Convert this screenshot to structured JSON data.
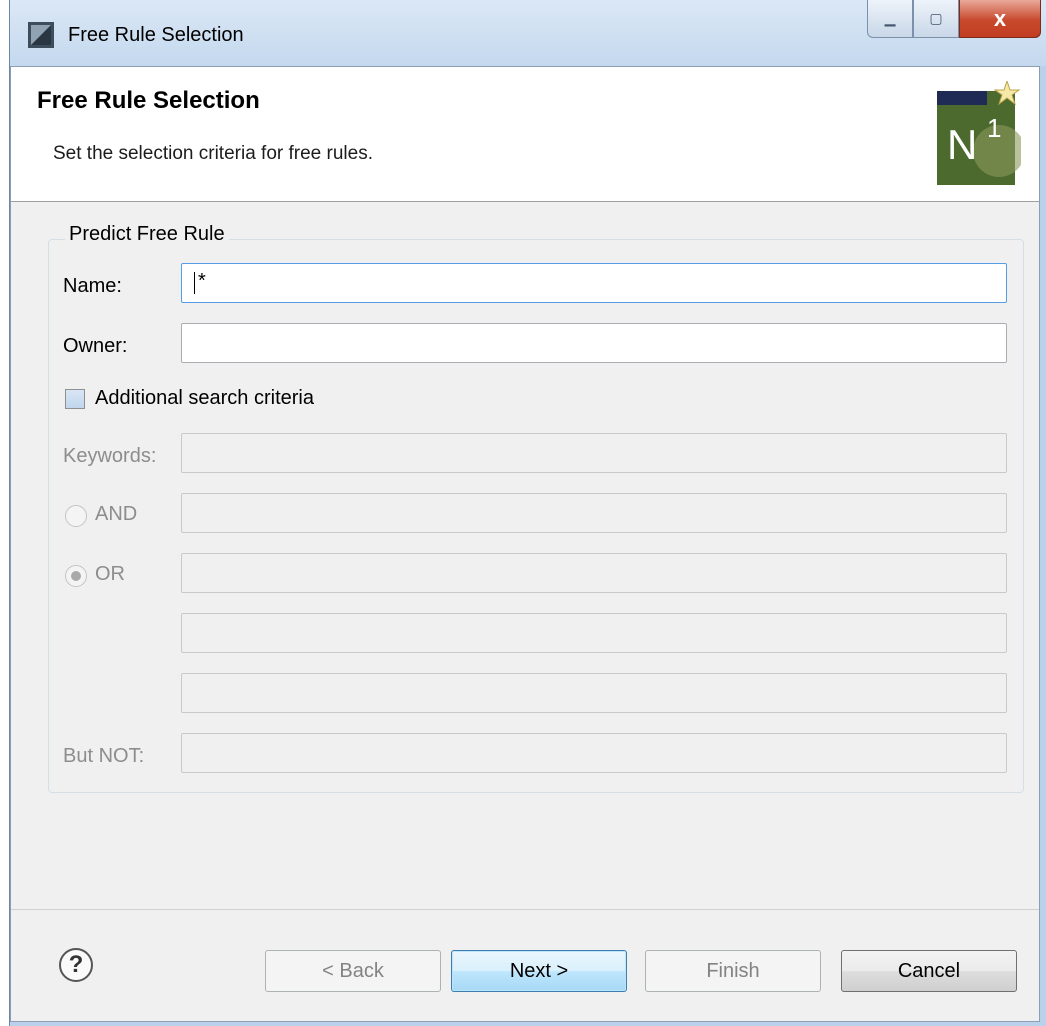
{
  "window": {
    "title": "Free Rule Selection",
    "minimize_glyph": "▁",
    "maximize_glyph": "▢",
    "close_glyph": "x"
  },
  "header": {
    "title": "Free Rule Selection",
    "description": "Set the selection criteria for free rules.",
    "logo_text": "N",
    "logo_superscript": "1"
  },
  "group": {
    "legend": "Predict Free Rule",
    "name_label": "Name:",
    "name_value": "*",
    "owner_label": "Owner:",
    "owner_value": "",
    "additional_label": "Additional search criteria",
    "additional_checked": false,
    "keywords_label": "Keywords:",
    "and_label": "AND",
    "or_label": "OR",
    "or_selected": true,
    "but_not_label": "But NOT:"
  },
  "footer": {
    "help_glyph": "?",
    "back_label": "< Back",
    "next_label": "Next >",
    "finish_label": "Finish",
    "cancel_label": "Cancel"
  },
  "colors": {
    "accent": "#569de5",
    "close_button": "#c8492d",
    "disabled_text": "#8d8d8d"
  }
}
